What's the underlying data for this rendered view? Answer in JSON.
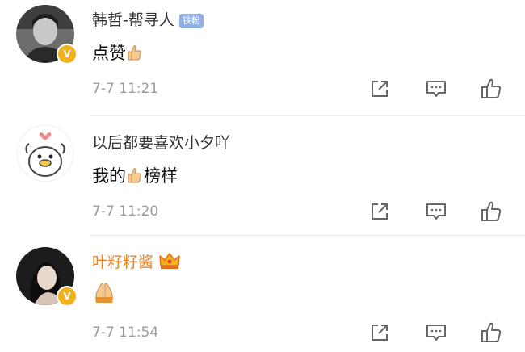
{
  "comments": [
    {
      "user": "韩哲-帮寻人",
      "badge": "铁粉",
      "text": "点赞",
      "time": "7-7 11:21",
      "verified": "V"
    },
    {
      "user": "以后都要喜欢小夕吖",
      "text_before": "我的",
      "text_after": "榜样",
      "time": "7-7 11:20"
    },
    {
      "user": "叶籽籽酱",
      "time": "7-7 11:54",
      "verified": "V"
    }
  ],
  "colors": {
    "vip_name": "#e8832a",
    "verified_badge": "#f2b21c",
    "fan_badge": "#8fb1e3",
    "time": "#9a9a9a"
  },
  "icons": {
    "share": "share-icon",
    "reply": "comment-icon",
    "like": "thumbs-up-icon"
  }
}
